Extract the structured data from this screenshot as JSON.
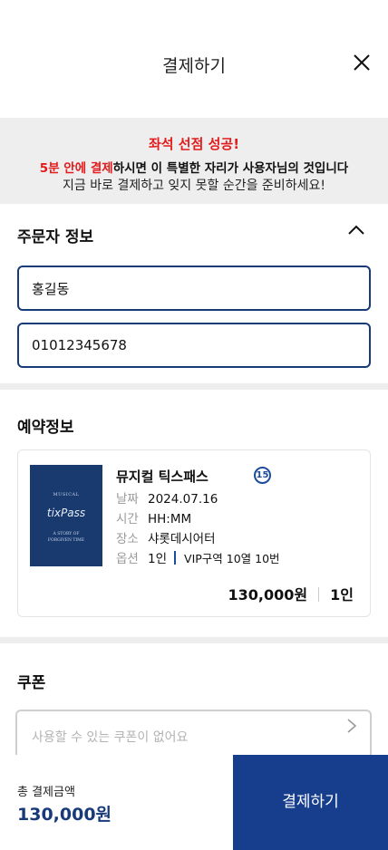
{
  "header": {
    "title": "결제하기"
  },
  "banner": {
    "line1": "좌석 선점 성공!",
    "line2_highlight": "5분 안에 결제",
    "line2_rest": "하시면 이 특별한 자리가 사용자님의 것입니다",
    "line3": "지금 바로 결제하고 잊지 못할 순간을 준비하세요!"
  },
  "orderer": {
    "title": "주문자 정보",
    "name_value": "홍길동",
    "phone_value": "01012345678"
  },
  "reservation": {
    "title": "예약정보",
    "poster": {
      "small": "MUSICAL",
      "logo": "tixPass",
      "sub1": "A STORY OF",
      "sub2": "FORGIVEN TIME"
    },
    "show_title": "뮤지컬 틱스패스",
    "age_badge": "15",
    "date_label": "날짜",
    "date_value": "2024.07.16",
    "time_label": "시간",
    "time_value": "HH:MM",
    "place_label": "장소",
    "place_value": "샤롯데시어터",
    "option_label": "옵션",
    "option_count": "1인",
    "option_seat": "VIP구역 10열 10번",
    "price": "130,000원",
    "qty": "1인"
  },
  "coupon": {
    "title": "쿠폰",
    "placeholder": "사용할 수 있는 쿠폰이 없어요"
  },
  "footer": {
    "total_label": "총 결제금액",
    "total_value": "130,000원",
    "pay_label": "결제하기"
  },
  "colors": {
    "accent": "#163e8c",
    "alert": "#e31b1b",
    "field_border": "#173a78"
  }
}
